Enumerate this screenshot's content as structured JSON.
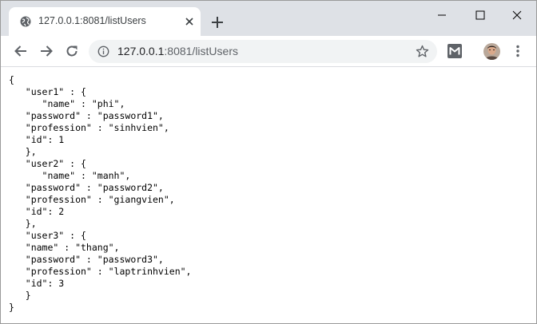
{
  "tab": {
    "title": "127.0.0.1:8081/listUsers"
  },
  "address_bar": {
    "host": "127.0.0.1",
    "path": ":8081/listUsers"
  },
  "icons": {
    "favicon": "globe-icon",
    "tab_close": "close-icon",
    "new_tab": "plus-icon",
    "back": "arrow-left-icon",
    "forward": "arrow-right-icon",
    "reload": "reload-icon",
    "site_info": "info-icon",
    "bookmark": "star-icon",
    "extension": "gmail-m-icon",
    "menu": "kebab-menu-icon"
  },
  "page_text": "{\n   \"user1\" : {\n      \"name\" : \"phi\",\n   \"password\" : \"password1\",\n   \"profession\" : \"sinhvien\",\n   \"id\": 1\n   },\n   \"user2\" : {\n      \"name\" : \"manh\",\n   \"password\" : \"password2\",\n   \"profession\" : \"giangvien\",\n   \"id\": 2\n   },\n   \"user3\" : {\n   \"name\" : \"thang\",\n   \"password\" : \"password3\",\n   \"profession\" : \"laptrinhvien\",\n   \"id\": 3\n   }\n}"
}
